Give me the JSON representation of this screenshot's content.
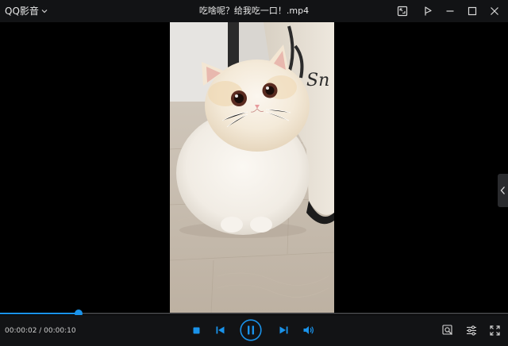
{
  "app": {
    "name": "QQ影音"
  },
  "window": {
    "title": "吃啥呢？给我吃一口！.mp4"
  },
  "icons": {
    "app_menu": "chevron-down-icon",
    "screenshot": "screenshot-icon",
    "pin": "pin-icon",
    "minimize": "minimize-icon",
    "maximize": "maximize-icon",
    "close": "close-icon",
    "side_panel": "chevron-left-icon",
    "stop": "stop-icon",
    "previous": "skip-previous-icon",
    "pause": "pause-icon",
    "next": "skip-next-icon",
    "volume": "volume-icon",
    "image_enhance": "image-search-icon",
    "settings": "equalizer-settings-icon",
    "fullscreen": "fullscreen-icon"
  },
  "player": {
    "time_display": "00:00:02 / 00:00:10",
    "current_seconds": 2,
    "duration_seconds": 10,
    "progress_fraction": 0.155
  },
  "colors": {
    "accent": "#1a93ea",
    "chrome": "#121315",
    "video_background": "#000000"
  }
}
